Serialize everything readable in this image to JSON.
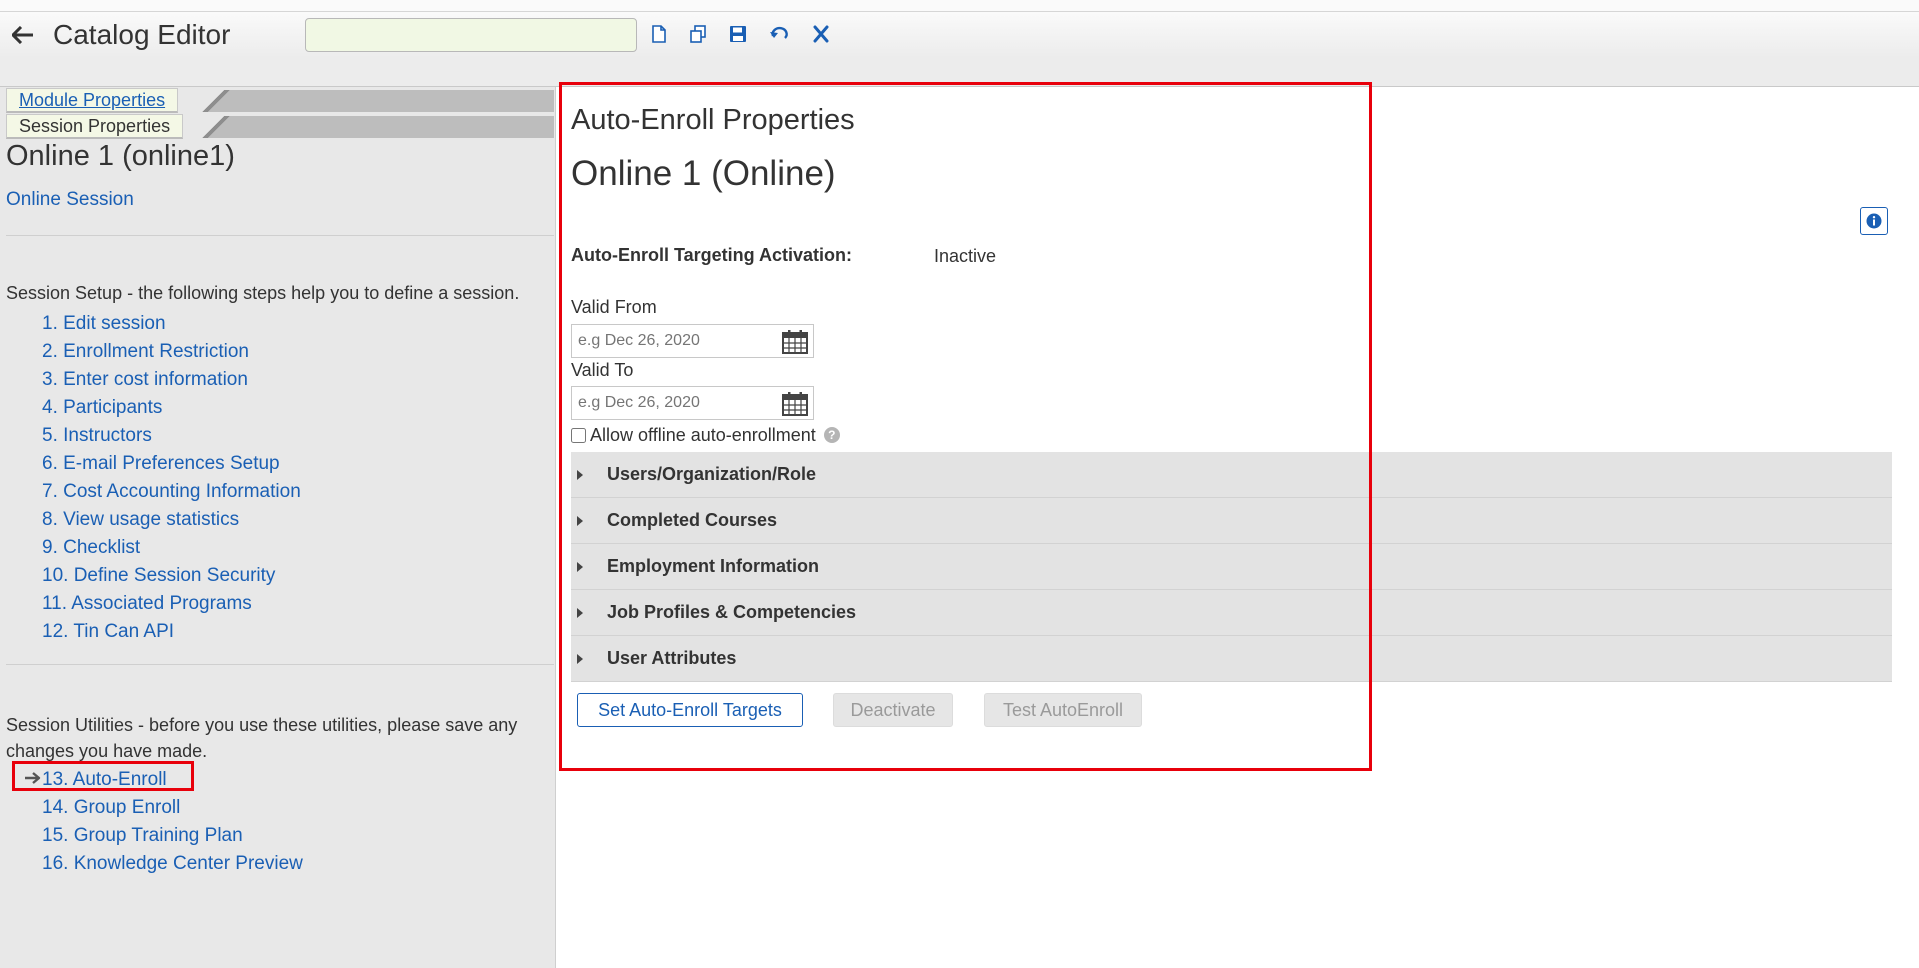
{
  "app": {
    "title": "Catalog Editor",
    "search_value": ""
  },
  "toolbar": {
    "icons": [
      "new-document-icon",
      "copy-icon",
      "save-icon",
      "undo-icon",
      "close-x-icon"
    ]
  },
  "left": {
    "tabs": [
      {
        "label": "Module Properties"
      },
      {
        "label": "Session Properties"
      }
    ],
    "session_title": "Online 1 (online1)",
    "session_type": "Online Session",
    "setup_intro": "Session Setup - the following steps help you to define a session.",
    "setup_steps": [
      "1. Edit session",
      "2. Enrollment Restriction",
      "3. Enter cost information",
      "4. Participants",
      "5. Instructors",
      "6. E-mail Preferences Setup",
      "7. Cost Accounting Information",
      "8. View usage statistics",
      "9. Checklist",
      "10. Define Session Security",
      "11. Associated Programs",
      "12. Tin Can API"
    ],
    "utilities_intro": "Session Utilities - before you use these utilities, please save any changes you have made.",
    "utilities": [
      "13. Auto-Enroll",
      "14. Group Enroll",
      "15. Group Training Plan",
      "16. Knowledge Center Preview"
    ]
  },
  "main": {
    "heading": "Auto-Enroll Properties",
    "module_name": "Online 1 (Online)",
    "activation_label": "Auto-Enroll Targeting Activation:",
    "activation_value": "Inactive",
    "valid_from_label": "Valid From",
    "valid_from_placeholder": "e.g Dec 26, 2020",
    "valid_to_label": "Valid To",
    "valid_to_placeholder": "e.g Dec 26, 2020",
    "offline_label": "Allow offline auto-enrollment",
    "offline_checked": false,
    "help_glyph": "?",
    "sections": [
      "Users/Organization/Role",
      "Completed Courses",
      "Employment Information",
      "Job Profiles & Competencies",
      "User Attributes"
    ],
    "buttons": {
      "set_targets": "Set Auto-Enroll Targets",
      "deactivate": "Deactivate",
      "test": "Test AutoEnroll"
    }
  },
  "colors": {
    "link": "#1a5fb4",
    "highlight": "#e8000b",
    "panel_bg": "#e8e8e8",
    "search_bg": "#f1f8e4"
  }
}
